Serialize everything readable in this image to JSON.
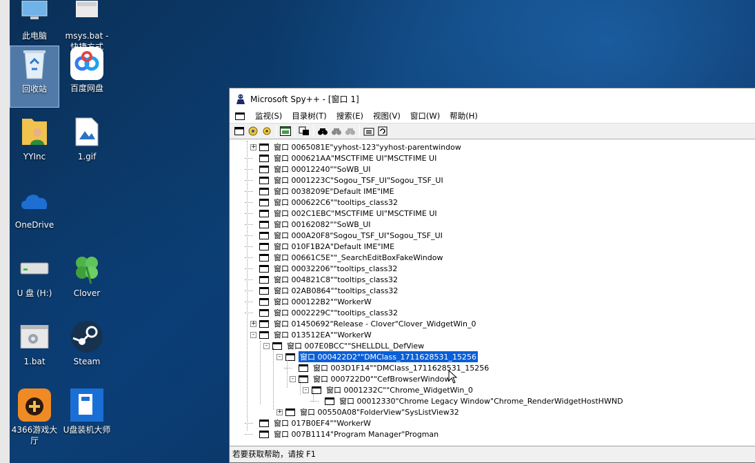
{
  "desktop": {
    "icons": [
      {
        "label": "此电脑",
        "icon": "computer-icon"
      },
      {
        "label": "msys.bat - 快捷方式",
        "icon": "shortcut-icon"
      },
      {
        "label": "回收站",
        "icon": "recycle-bin-icon"
      },
      {
        "label": "百度网盘",
        "icon": "baidu-netdisk-icon"
      },
      {
        "label": "YYInc",
        "icon": "folder-user-icon"
      },
      {
        "label": "1.gif",
        "icon": "image-file-icon"
      },
      {
        "label": "OneDrive",
        "icon": "cloud-icon"
      },
      {
        "label": "U 盘 (H:)",
        "icon": "drive-icon"
      },
      {
        "label": "Clover",
        "icon": "clover-icon"
      },
      {
        "label": "1.bat",
        "icon": "batch-file-icon"
      },
      {
        "label": "Steam",
        "icon": "steam-icon"
      },
      {
        "label": "4366游戏大厅",
        "icon": "game-hall-icon"
      },
      {
        "label": "U盘装机大师",
        "icon": "usb-installer-icon"
      }
    ]
  },
  "window": {
    "title": "Microsoft Spy++ - [窗口 1]",
    "menu": [
      "监视(S)",
      "目录树(T)",
      "搜索(E)",
      "视图(V)",
      "窗口(W)",
      "帮助(H)"
    ],
    "toolbar_icons": [
      "window-icon",
      "processes-icon",
      "threads-icon",
      "messages-icon",
      "log-icon",
      "find-window-icon",
      "find-icon",
      "find-next-icon",
      "find-prev-icon",
      "properties-icon",
      "refresh-icon"
    ],
    "status": "若要获取帮助，请按 F1"
  },
  "tree": [
    {
      "text": "窗口 0065081E\"yyhost-123\"yyhost-parentwindow",
      "level": 1,
      "exp": "+"
    },
    {
      "text": "窗口 000621AA\"MSCTFIME UI\"MSCTFIME UI",
      "level": 1,
      "exp": ""
    },
    {
      "text": "窗口 00012240\"\"SoWB_UI",
      "level": 1,
      "exp": ""
    },
    {
      "text": "窗口 0001223C\"Sogou_TSF_UI\"Sogou_TSF_UI",
      "level": 1,
      "exp": ""
    },
    {
      "text": "窗口 0038209E\"Default IME\"IME",
      "level": 1,
      "exp": ""
    },
    {
      "text": "窗口 000622C6\"\"tooltips_class32",
      "level": 1,
      "exp": ""
    },
    {
      "text": "窗口 002C1EBC\"MSCTFIME UI\"MSCTFIME UI",
      "level": 1,
      "exp": ""
    },
    {
      "text": "窗口 00162082\"\"SoWB_UI",
      "level": 1,
      "exp": ""
    },
    {
      "text": "窗口 000A20F8\"Sogou_TSF_UI\"Sogou_TSF_UI",
      "level": 1,
      "exp": ""
    },
    {
      "text": "窗口 010F1B2A\"Default IME\"IME",
      "level": 1,
      "exp": ""
    },
    {
      "text": "窗口 00661C5E\"\"_SearchEditBoxFakeWindow",
      "level": 1,
      "exp": ""
    },
    {
      "text": "窗口 00032206\"\"tooltips_class32",
      "level": 1,
      "exp": ""
    },
    {
      "text": "窗口 004821C8\"\"tooltips_class32",
      "level": 1,
      "exp": ""
    },
    {
      "text": "窗口 02AB0864\"\"tooltips_class32",
      "level": 1,
      "exp": ""
    },
    {
      "text": "窗口 000122B2\"\"WorkerW",
      "level": 1,
      "exp": ""
    },
    {
      "text": "窗口 0002229C\"\"tooltips_class32",
      "level": 1,
      "exp": ""
    },
    {
      "text": "窗口 01450692\"Release - Clover\"Clover_WidgetWin_0",
      "level": 1,
      "exp": "+"
    },
    {
      "text": "窗口 013512EA\"\"WorkerW",
      "level": 1,
      "exp": "-"
    },
    {
      "text": "窗口 007E0BCC\"\"SHELLDLL_DefView",
      "level": 2,
      "exp": "-"
    },
    {
      "text": "窗口 000422D2\"\"DMClass_1711628531_15256",
      "level": 3,
      "exp": "-",
      "selected": true
    },
    {
      "text": "窗口 003D1F14\"\"DMClass_1711628531_15256",
      "level": 4,
      "exp": ""
    },
    {
      "text": "窗口 000722D0\"\"CefBrowserWindow",
      "level": 4,
      "exp": "-"
    },
    {
      "text": "窗口 0001232C\"\"Chrome_WidgetWin_0",
      "level": 5,
      "exp": "-"
    },
    {
      "text": "窗口 00012330\"Chrome Legacy Window\"Chrome_RenderWidgetHostHWND",
      "level": 6,
      "exp": ""
    },
    {
      "text": "窗口 00550A08\"FolderView\"SysListView32",
      "level": 3,
      "exp": "+"
    },
    {
      "text": "窗口 017B0EF4\"\"WorkerW",
      "level": 1,
      "exp": ""
    },
    {
      "text": "窗口 007B1114\"Program Manager\"Progman",
      "level": 1,
      "exp": ""
    }
  ]
}
